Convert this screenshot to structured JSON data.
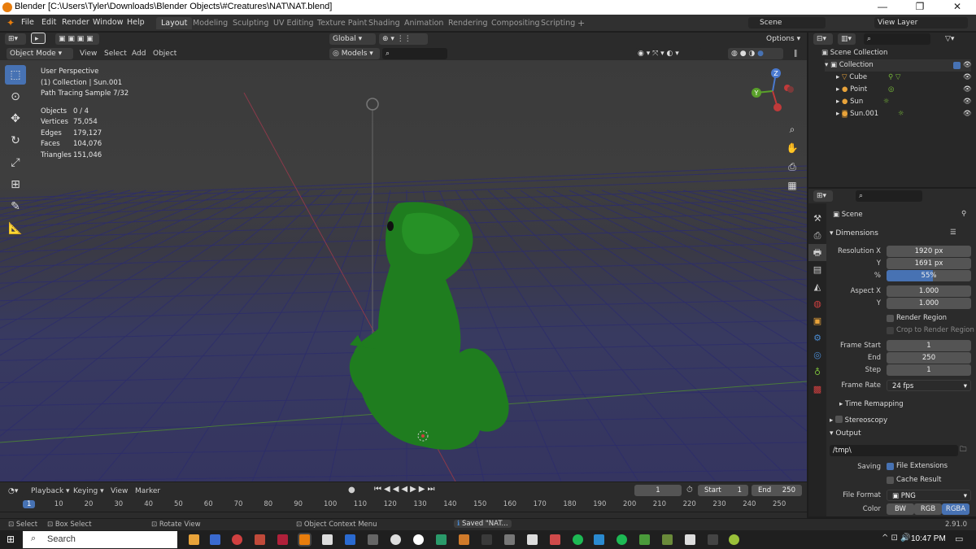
{
  "window": {
    "title": "Blender [C:\\Users\\Tyler\\Downloads\\Blender Objects\\#Creatures\\NAT\\NAT.blend]",
    "minimize": "—",
    "maximize": "❐",
    "close": "✕"
  },
  "menu": [
    "File",
    "Edit",
    "Render",
    "Window",
    "Help"
  ],
  "workspaces": [
    "Layout",
    "Modeling",
    "Sculpting",
    "UV Editing",
    "Texture Paint",
    "Shading",
    "Animation",
    "Rendering",
    "Compositing",
    "Scripting"
  ],
  "scene": {
    "label": "Scene",
    "view_layer": "View Layer"
  },
  "header": {
    "orientation": "Global",
    "options": "Options",
    "mode": "Object Mode",
    "view": "View",
    "select": "Select",
    "add": "Add",
    "object": "Object",
    "models": "Models"
  },
  "viewport": {
    "info": [
      "User Perspective",
      "(1) Collection | Sun.001",
      "Path Tracing Sample 7/32"
    ],
    "stats": [
      {
        "k": "Objects",
        "v": "0 / 4"
      },
      {
        "k": "Vertices",
        "v": "75,054"
      },
      {
        "k": "Edges",
        "v": "179,127"
      },
      {
        "k": "Faces",
        "v": "104,076"
      },
      {
        "k": "Triangles",
        "v": "151,046"
      }
    ],
    "gizmo": {
      "x": "X",
      "y": "Y",
      "z": "Z"
    }
  },
  "outliner": {
    "root": "Scene Collection",
    "collection": "Collection",
    "items": [
      {
        "name": "Cube",
        "color": "#e8a33a"
      },
      {
        "name": "Point",
        "color": "#e8a33a"
      },
      {
        "name": "Sun",
        "color": "#e8a33a"
      },
      {
        "name": "Sun.001",
        "color": "#e8a33a"
      }
    ]
  },
  "properties": {
    "scene": "Scene",
    "dimensions": "Dimensions",
    "res_x_label": "Resolution X",
    "res_x": "1920 px",
    "res_y_label": "Y",
    "res_y": "1691 px",
    "pct_label": "%",
    "pct": "55%",
    "pct_value": 0.55,
    "aspect_x_label": "Aspect X",
    "aspect_x": "1.000",
    "aspect_y_label": "Y",
    "aspect_y": "1.000",
    "render_region": "Render Region",
    "crop": "Crop to Render Region",
    "frame_start_label": "Frame Start",
    "frame_start": "1",
    "end_label": "End",
    "end": "250",
    "step_label": "Step",
    "step": "1",
    "frame_rate_label": "Frame Rate",
    "frame_rate": "24 fps",
    "time_remapping": "Time Remapping",
    "stereoscopy": "Stereoscopy",
    "output": "Output",
    "path": "/tmp\\",
    "saving": "Saving",
    "file_ext": "File Extensions",
    "cache": "Cache Result",
    "file_format_label": "File Format",
    "file_format": "PNG",
    "color_label": "Color",
    "color_opts": [
      "BW",
      "RGB",
      "RGBA"
    ]
  },
  "timeline": {
    "playback": "Playback",
    "keying": "Keying",
    "view": "View",
    "marker": "Marker",
    "current": "1",
    "start_label": "Start",
    "start": "1",
    "end_label": "End",
    "end": "250",
    "ticks": [
      "1",
      "10",
      "20",
      "30",
      "40",
      "50",
      "60",
      "70",
      "80",
      "90",
      "100",
      "110",
      "120",
      "130",
      "140",
      "150",
      "160",
      "170",
      "180",
      "190",
      "200",
      "210",
      "220",
      "230",
      "240",
      "250"
    ]
  },
  "status": {
    "select": "Select",
    "box": "Box Select",
    "rotate": "Rotate View",
    "context": "Object Context Menu",
    "saved": "Saved \"NAT...",
    "version": "2.91.0"
  },
  "taskbar": {
    "search": "Search",
    "time": "10:47 PM"
  }
}
